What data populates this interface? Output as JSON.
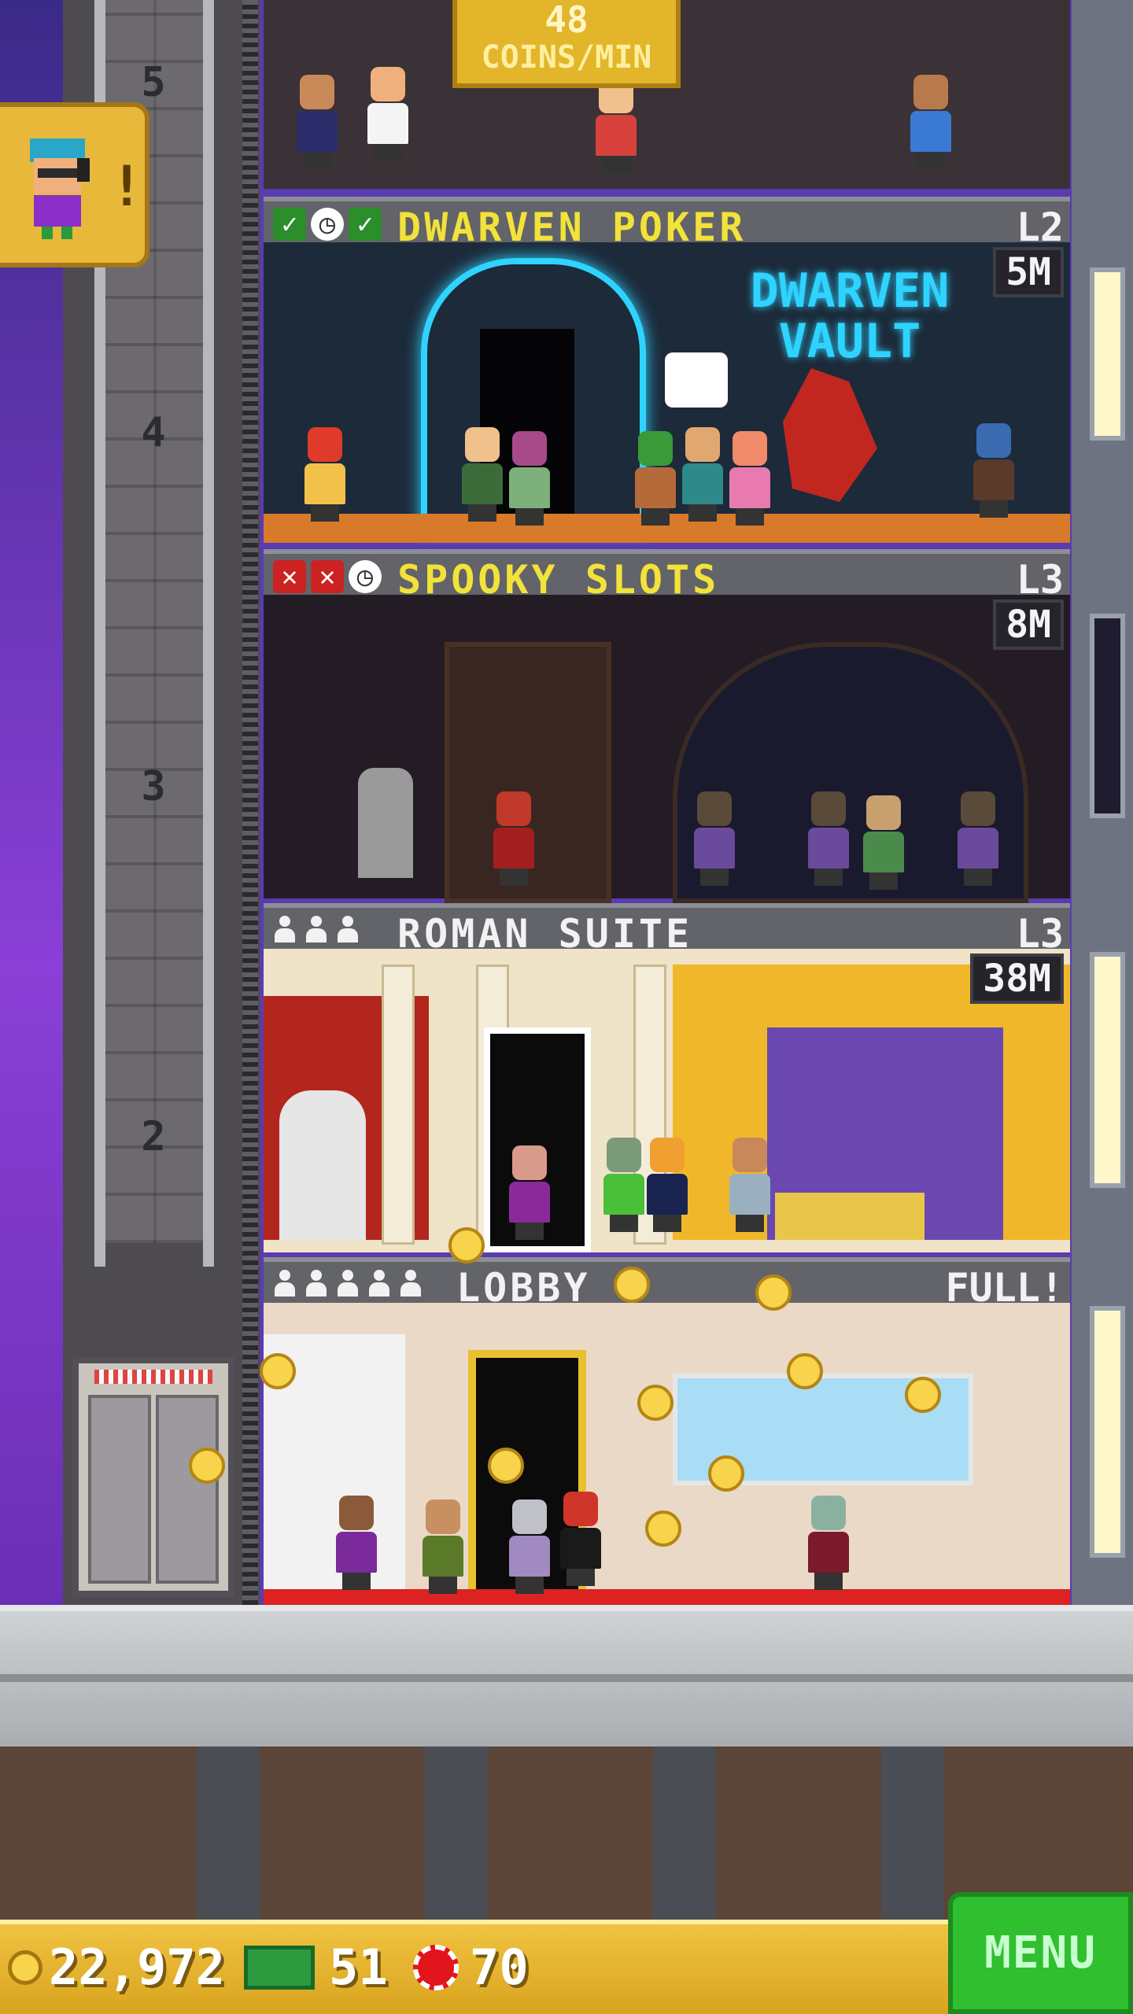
{
  "header": {
    "coins_per_min_value": "48",
    "coins_per_min_label": "COINS/MIN"
  },
  "shaft": {
    "floor_numbers": [
      "5",
      "4",
      "3",
      "2"
    ]
  },
  "floors": [
    {
      "name": "DWARVEN POKER",
      "level": "L2",
      "timer": "5M",
      "status_icons": [
        "check-icon",
        "clock-icon",
        "check-icon"
      ],
      "sign_text": "DWARVEN VAULT"
    },
    {
      "name": "SPOOKY SLOTS",
      "level": "L3",
      "timer": "8M",
      "status_icons": [
        "x-icon",
        "x-icon",
        "clock-icon"
      ]
    },
    {
      "name": "ROMAN SUITE",
      "level": "L3",
      "timer": "38M",
      "occupants": 3
    },
    {
      "name": "LOBBY",
      "level": "FULL!",
      "occupants": 5
    }
  ],
  "bottom_bar": {
    "coins": "22,972",
    "bux": "51",
    "chips": "70",
    "menu_label": "MENU"
  },
  "colors": {
    "floor_name_yellow": "#f2e23a",
    "floor_name_white": "#f2f2f2",
    "bottom_bar": "#e4b12e",
    "menu_green": "#2fbf2f"
  }
}
